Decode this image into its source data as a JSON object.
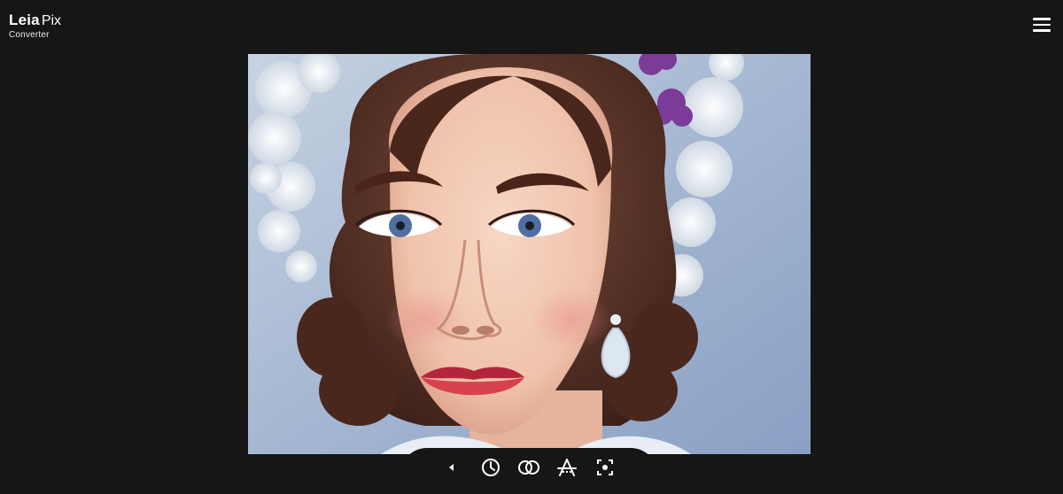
{
  "header": {
    "brand": "Leia",
    "product": "Pix",
    "subtitle": "Converter",
    "menu_icon": "hamburger-menu-icon"
  },
  "viewer": {
    "image_subject": "portrait"
  },
  "toolbar": {
    "tools": [
      {
        "icon": "collapse-left-icon"
      },
      {
        "icon": "clock-animation-icon"
      },
      {
        "icon": "overlapping-circles-icon"
      },
      {
        "icon": "depth-perspective-icon"
      },
      {
        "icon": "focus-target-icon"
      }
    ]
  },
  "colors": {
    "background": "#161616",
    "foreground": "#ffffff"
  }
}
